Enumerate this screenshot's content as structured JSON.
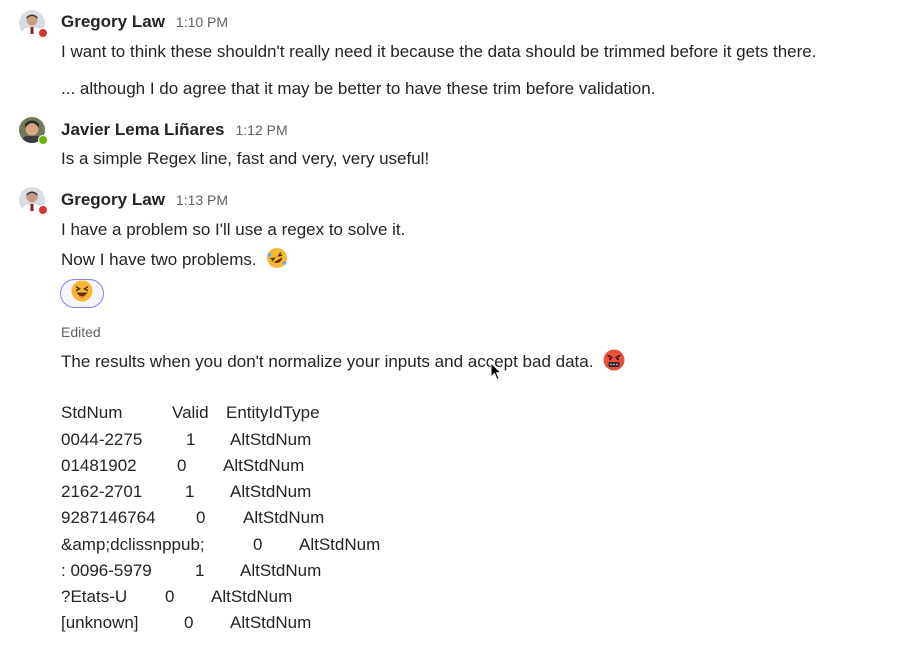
{
  "messages": [
    {
      "author": "Gregory Law",
      "time": "1:10 PM",
      "presence": "busy",
      "lines": [
        "I want to think these shouldn't really need it because the data should be trimmed before it gets there.",
        "... although I do agree that it may be better to have these trim before validation."
      ]
    },
    {
      "author": "Javier Lema Liñares",
      "time": "1:12 PM",
      "presence": "available",
      "lines": [
        "Is a simple Regex line, fast and very, very useful!"
      ]
    },
    {
      "author": "Gregory Law",
      "time": "1:13 PM",
      "presence": "busy",
      "lines": [
        "I have a problem so I'll use a regex to solve it.",
        "Now I have two problems."
      ],
      "inline_emoji": "rolling-on-floor-laughing-emoji",
      "reaction": "laughing-emoji"
    }
  ],
  "edited_message": {
    "edited_label": "Edited",
    "text": "The results when you don't normalize your inputs and accept bad data.",
    "inline_emoji": "cursing-face-emoji",
    "table": {
      "headers": [
        "StdNum",
        "Valid",
        "EntityIdType"
      ],
      "rows": [
        [
          "0044-2275",
          "1",
          "AltStdNum"
        ],
        [
          "01481902",
          "0",
          "AltStdNum"
        ],
        [
          "2162-2701",
          "1",
          "AltStdNum"
        ],
        [
          "9287146764",
          "0",
          "AltStdNum"
        ],
        [
          "&amp;dclissnppub;",
          "0",
          "AltStdNum"
        ],
        [
          ": 0096-5979",
          "1",
          "AltStdNum"
        ],
        [
          "?Etats-U",
          "0",
          "AltStdNum"
        ],
        [
          "[unknown]",
          "0",
          "AltStdNum"
        ]
      ]
    }
  },
  "colors": {
    "busy": "#d13438",
    "available": "#6bb700",
    "reaction_border": "#7f85f5",
    "meta_text": "#616161"
  }
}
